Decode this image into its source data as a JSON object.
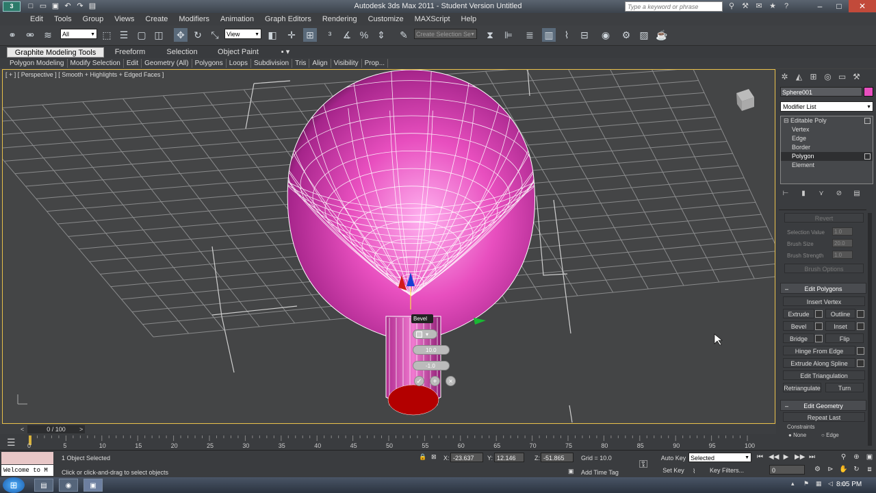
{
  "window": {
    "title": "Autodesk 3ds Max  2011   - Student Version   Untitled",
    "search_placeholder": "Type a keyword or phrase",
    "app_icon": "3ds-max-logo"
  },
  "menu": [
    "Edit",
    "Tools",
    "Group",
    "Views",
    "Create",
    "Modifiers",
    "Animation",
    "Graph Editors",
    "Rendering",
    "Customize",
    "MAXScript",
    "Help"
  ],
  "toolbar": {
    "selection_filter": "All",
    "ref_coord": "View",
    "named_selection": "Create Selection Se"
  },
  "ribbon_tabs": [
    "Graphite Modeling Tools",
    "Freeform",
    "Selection",
    "Object Paint"
  ],
  "ribbon_panels": [
    "Polygon Modeling",
    "Modify Selection",
    "Edit",
    "Geometry (All)",
    "Polygons",
    "Loops",
    "Subdivision",
    "Tris",
    "Align",
    "Visibility",
    "Prop..."
  ],
  "viewport": {
    "label": "[ + ] [ Perspective ] [ Smooth + Highlights + Edged Faces ]",
    "object_color": "#e84fbf",
    "cap_color": "#b30000"
  },
  "caddy": {
    "title": "Bevel",
    "height": "10.0",
    "outline": "-1.0",
    "ok": "✓",
    "apply": "+",
    "cancel": "×"
  },
  "command_panel": {
    "object_name": "Sphere001",
    "object_color": "#e84fbf",
    "modifier_list": "Modifier List",
    "stack": [
      "Editable Poly",
      "Vertex",
      "Edge",
      "Border",
      "Polygon",
      "Element"
    ],
    "soft_selection": {
      "revert": "Revert",
      "selection_value_label": "Selection Value",
      "selection_value": "1.0",
      "brush_size_label": "Brush Size",
      "brush_size": "20.0",
      "brush_strength_label": "Brush Strength",
      "brush_strength": "1.0",
      "brush_options": "Brush Options"
    },
    "edit_polygons": {
      "title": "Edit Polygons",
      "insert_vertex": "Insert Vertex",
      "extrude": "Extrude",
      "outline": "Outline",
      "bevel": "Bevel",
      "inset": "Inset",
      "bridge": "Bridge",
      "flip": "Flip",
      "hinge": "Hinge From Edge",
      "extrude_spline": "Extrude Along Spline",
      "edit_tri": "Edit Triangulation",
      "retriangulate": "Retriangulate",
      "turn": "Turn"
    },
    "edit_geometry": {
      "title": "Edit Geometry",
      "repeat_last": "Repeat Last",
      "constraints": "Constraints",
      "none": "None",
      "edge": "Edge"
    }
  },
  "timeline": {
    "slider": "0 / 100",
    "prev": "<",
    "next": ">",
    "ticks": [
      "0",
      "5",
      "10",
      "15",
      "20",
      "25",
      "30",
      "35",
      "40",
      "45",
      "50",
      "55",
      "60",
      "65",
      "70",
      "75",
      "80",
      "85",
      "90",
      "95",
      "100"
    ]
  },
  "status": {
    "listener": "Welcome to M",
    "selected": "1 Object Selected",
    "prompt": "Click or click-and-drag to select objects",
    "x_label": "X:",
    "x": "-23.637",
    "y_label": "Y:",
    "y": "12.146",
    "z_label": "Z:",
    "z": "-51.865",
    "grid": "Grid = 10.0",
    "add_time_tag": "Add Time Tag",
    "auto_key": "Auto Key",
    "set_key": "Set Key",
    "key_mode": "Selected",
    "key_filters": "Key Filters...",
    "frame": "0"
  },
  "taskbar": {
    "clock": "8:05 PM"
  }
}
